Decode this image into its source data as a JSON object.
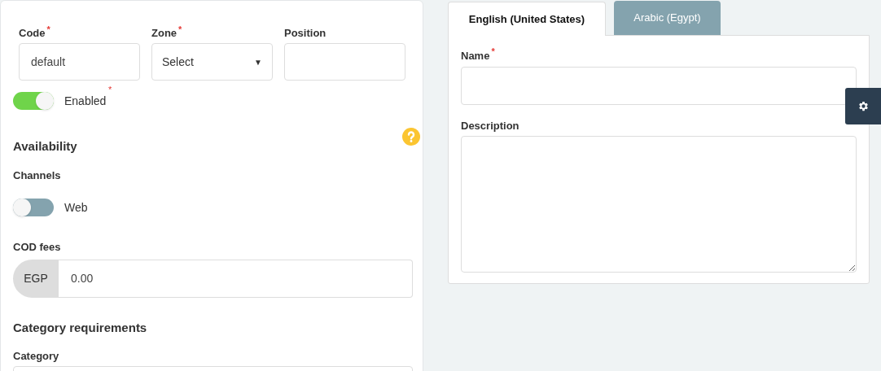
{
  "form": {
    "fields": [
      {
        "label": "Code",
        "required_mark": "*",
        "kind": "text",
        "value": "default"
      },
      {
        "label": "Zone",
        "required_mark": "*",
        "kind": "select",
        "value": "Select",
        "caret": "▼"
      },
      {
        "label": "Position",
        "kind": "text"
      }
    ],
    "enabled_toggle": {
      "label": "Enabled",
      "required_mark": "*",
      "on": true
    },
    "availability": {
      "heading": "Availability",
      "channels_label": "Channels",
      "channels": [
        {
          "label": "Web",
          "on": false
        }
      ]
    },
    "cod_fees": {
      "label": "COD fees",
      "prefix": "EGP",
      "value": "0.00"
    },
    "category_requirements": {
      "heading": "Category requirements",
      "category_label": "Category"
    }
  },
  "translations": {
    "tabs": [
      {
        "label": "English (United States)",
        "selected": true
      },
      {
        "label": "Arabic (Egypt)",
        "selected": false
      }
    ],
    "name": {
      "label": "Name",
      "required_mark": "*"
    },
    "description": {
      "label": "Description"
    }
  }
}
